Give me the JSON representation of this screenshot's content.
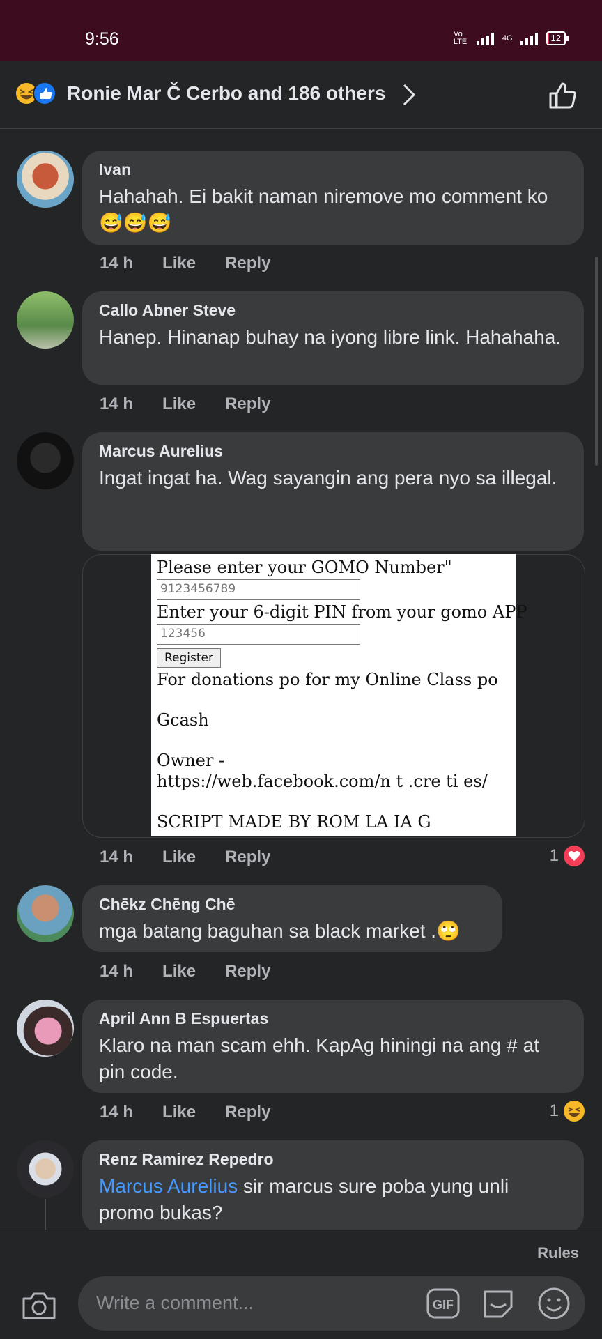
{
  "status": {
    "time": "9:56",
    "network": "Vo LTE",
    "signal2": "4G",
    "battery": "12"
  },
  "header": {
    "title": "Ronie Mar Č Cerbo and 186 others"
  },
  "comments": [
    {
      "name": "Ivan",
      "text": "Hahahah. Ei bakit naman niremove mo comment ko 😅😅😅",
      "time": "14 h"
    },
    {
      "name": "Callo Abner Steve",
      "text": "Hanep. Hinanap buhay na iyong libre link. Hahahaha.",
      "time": "14 h"
    },
    {
      "name": "Marcus Aurelius",
      "text": "Ingat ingat ha. Wag sayangin ang pera nyo sa illegal.",
      "time": "14 h",
      "reaction_count": "1"
    },
    {
      "name": "Chēkz Chēng Chē",
      "text": "mga batang baguhan sa black market .🙄",
      "time": "14 h"
    },
    {
      "name": "April Ann B Espuertas",
      "text": "Klaro na man scam ehh.  KapAg hiningi na ang # at pin code.",
      "time": "14 h",
      "reaction_count": "1"
    },
    {
      "name": "Renz Ramirez Repedro",
      "mention": "Marcus Aurelius",
      "text": " sir marcus sure poba yung unli promo bukas?"
    }
  ],
  "actions": {
    "like": "Like",
    "reply": "Reply"
  },
  "screenshot": {
    "line1": "Please enter your GOMO Number\"",
    "input1": "9123456789",
    "line2": "Enter your 6-digit PIN from your gomo APP",
    "input2": "123456",
    "button": "Register",
    "line3": "For donations po for my Online Class po",
    "line4": "Gcash",
    "line5": "Owner -",
    "line6": "https://web.facebook.com/n  t  .cre  ti  es/",
    "line7": "SCRIPT MADE BY     ROM    LA   IA   G"
  },
  "composer": {
    "rules": "Rules",
    "placeholder": "Write a comment..."
  },
  "colors": {
    "status_bg": "#3d0c1e",
    "bg": "#242526",
    "bubble": "#3a3b3c",
    "mention": "#4599ff",
    "heart": "#f33e58"
  }
}
